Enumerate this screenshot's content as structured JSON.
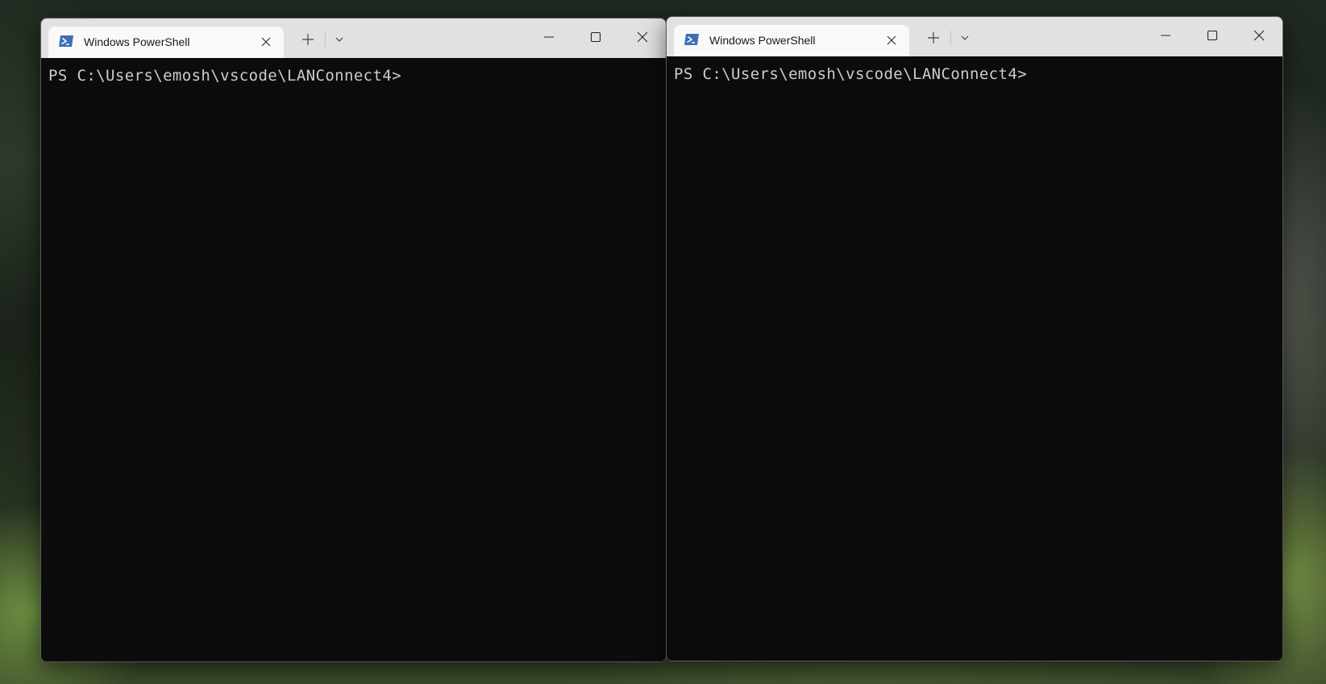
{
  "windows": [
    {
      "tab": {
        "title": "Windows PowerShell",
        "icon": "powershell-icon"
      },
      "new_tab_icon": "plus-icon",
      "dropdown_icon": "chevron-down-icon",
      "caption_icons": [
        "minimize-icon",
        "maximize-icon",
        "close-icon"
      ],
      "terminal": {
        "prompt": "PS C:\\Users\\emosh\\vscode\\LANConnect4>"
      }
    },
    {
      "tab": {
        "title": "Windows PowerShell",
        "icon": "powershell-icon"
      },
      "new_tab_icon": "plus-icon",
      "dropdown_icon": "chevron-down-icon",
      "caption_icons": [
        "minimize-icon",
        "maximize-icon",
        "close-icon"
      ],
      "terminal": {
        "prompt": "PS C:\\Users\\emosh\\vscode\\LANConnect4>"
      }
    }
  ],
  "colors": {
    "terminal_background": "#0c0c0c",
    "terminal_text": "#cccccc",
    "titlebar": "#e1e1e1",
    "active_tab": "#f9f9f9",
    "powershell_icon": "#3c6fb4"
  }
}
